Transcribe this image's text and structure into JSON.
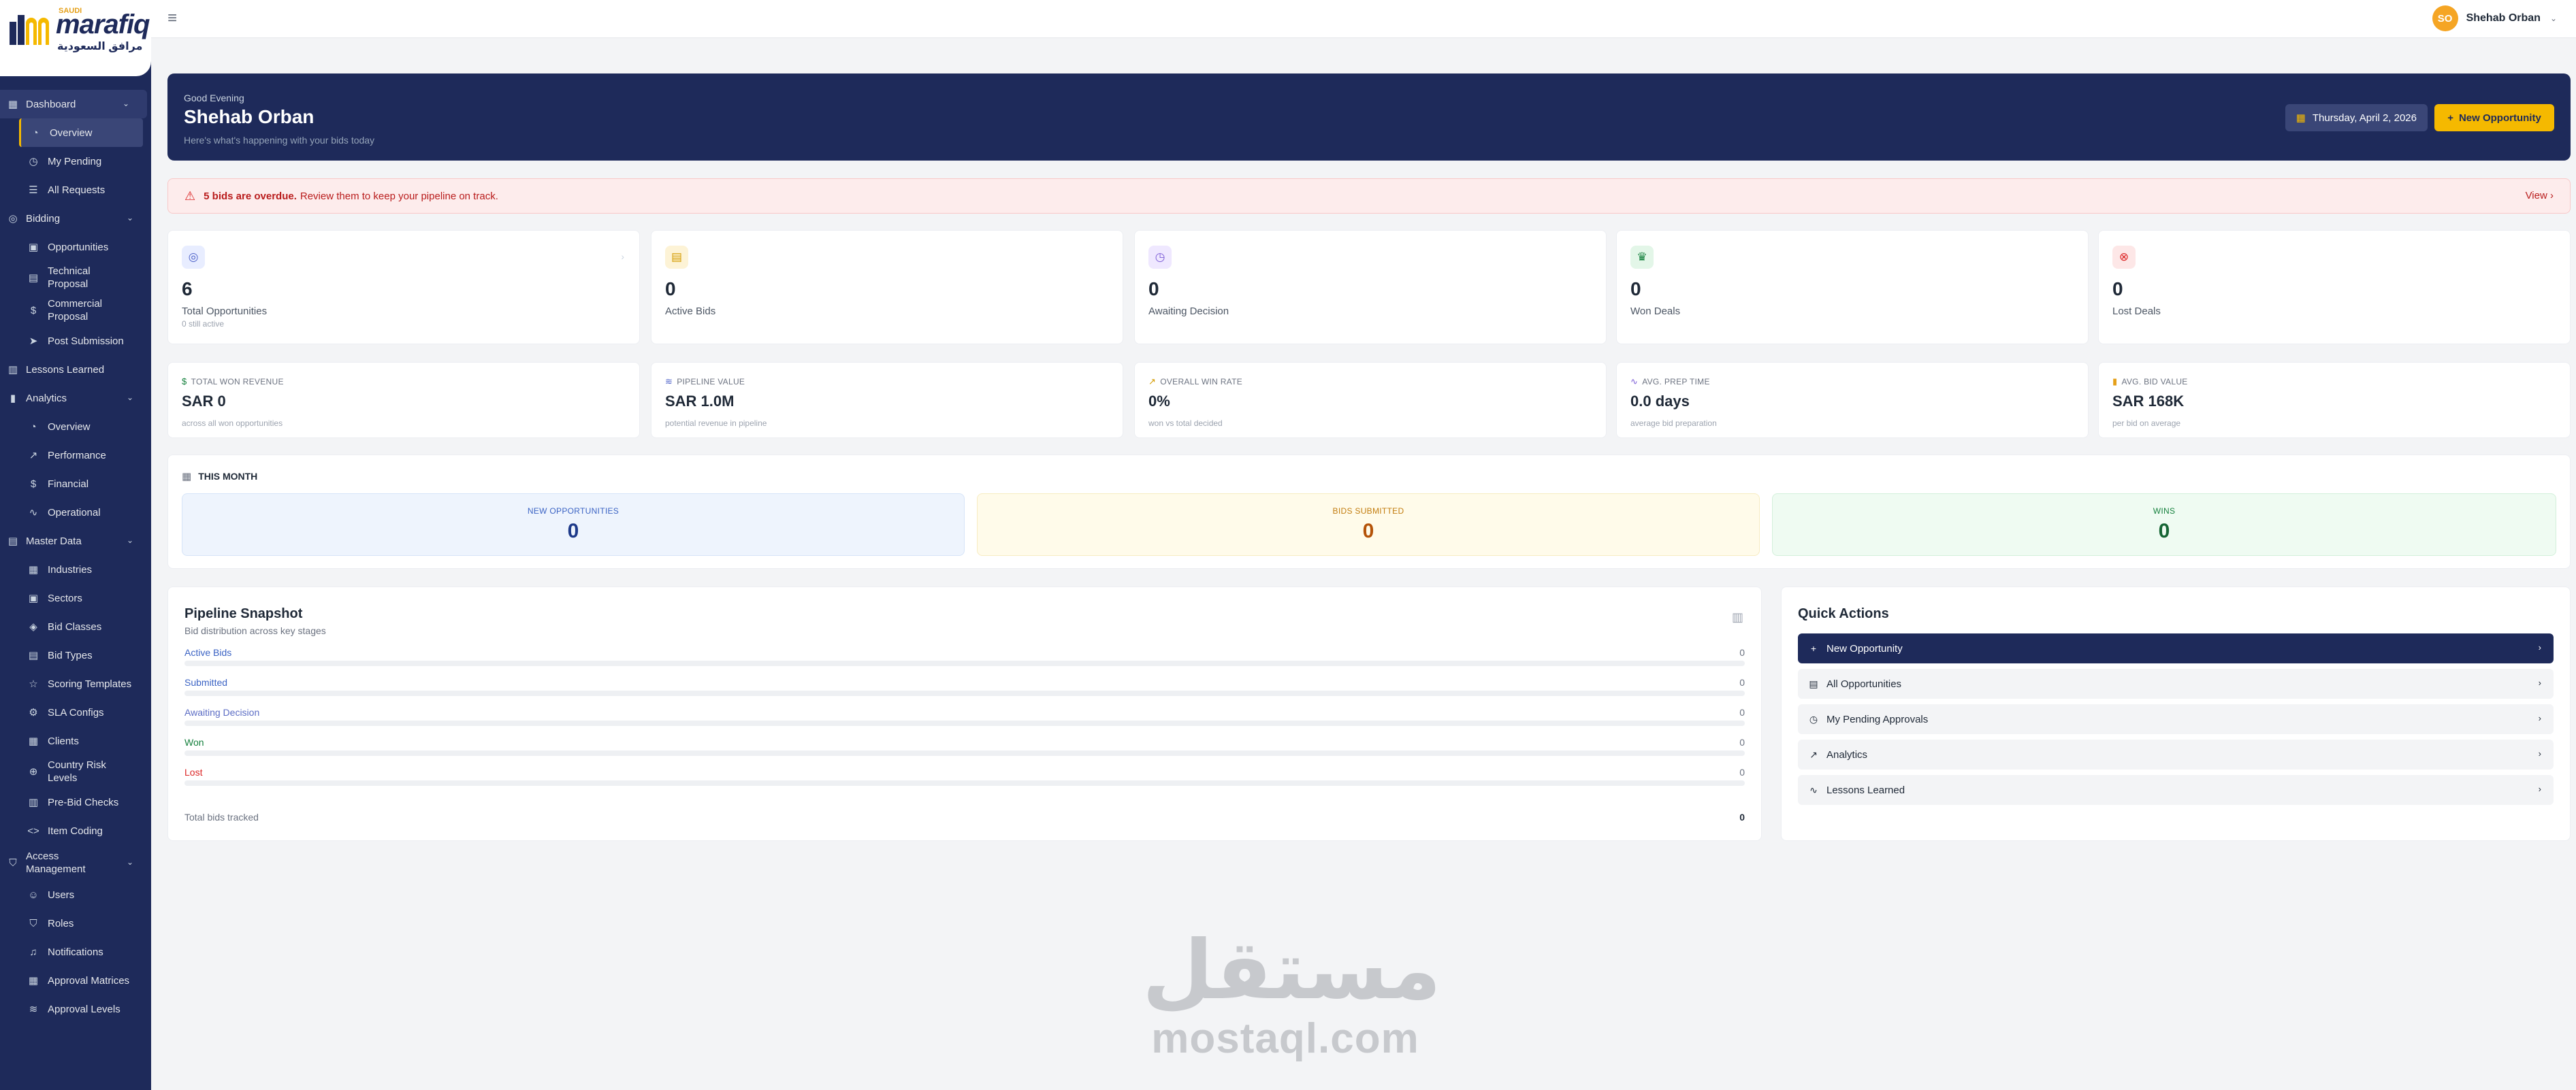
{
  "brand": {
    "name": "marafiq",
    "tag": "SAUDI",
    "arabic": "مرافق السعودية"
  },
  "topbar": {
    "user_initials": "SO",
    "user_name": "Shehab Orban"
  },
  "sidebar": {
    "dashboard": {
      "label": "Dashboard",
      "items": [
        "Overview",
        "My Pending",
        "All Requests"
      ]
    },
    "bidding": {
      "label": "Bidding",
      "items": [
        "Opportunities",
        "Technical Proposal",
        "Commercial Proposal",
        "Post Submission"
      ]
    },
    "lessons": {
      "label": "Lessons Learned"
    },
    "analytics": {
      "label": "Analytics",
      "items": [
        "Overview",
        "Performance",
        "Financial",
        "Operational"
      ]
    },
    "master": {
      "label": "Master Data",
      "items": [
        "Industries",
        "Sectors",
        "Bid Classes",
        "Bid Types",
        "Scoring Templates",
        "SLA Configs",
        "Clients",
        "Country Risk Levels",
        "Pre-Bid Checks",
        "Item Coding"
      ]
    },
    "access": {
      "label": "Access Management",
      "items": [
        "Users",
        "Roles",
        "Notifications",
        "Approval Matrices",
        "Approval Levels"
      ]
    }
  },
  "hero": {
    "greeting": "Good Evening",
    "name": "Shehab Orban",
    "subtitle": "Here's what's happening with your bids today",
    "date": "Thursday, April 2, 2026",
    "new_button": "New Opportunity"
  },
  "alert": {
    "bold": "5 bids are overdue.",
    "text": "Review them to keep your pipeline on track.",
    "view": "View"
  },
  "stats": [
    {
      "value": "6",
      "label": "Total Opportunities",
      "sub": "0 still active"
    },
    {
      "value": "0",
      "label": "Active Bids",
      "sub": ""
    },
    {
      "value": "0",
      "label": "Awaiting Decision",
      "sub": ""
    },
    {
      "value": "0",
      "label": "Won Deals",
      "sub": ""
    },
    {
      "value": "0",
      "label": "Lost Deals",
      "sub": ""
    }
  ],
  "metrics": [
    {
      "label": "TOTAL WON REVENUE",
      "value": "SAR 0",
      "sub": "across all won opportunities"
    },
    {
      "label": "PIPELINE VALUE",
      "value": "SAR 1.0M",
      "sub": "potential revenue in pipeline"
    },
    {
      "label": "OVERALL WIN RATE",
      "value": "0%",
      "sub": "won vs total decided"
    },
    {
      "label": "AVG. PREP TIME",
      "value": "0.0 days",
      "sub": "average bid preparation"
    },
    {
      "label": "AVG. BID VALUE",
      "value": "SAR 168K",
      "sub": "per bid on average"
    }
  ],
  "this_month": {
    "title": "THIS MONTH",
    "boxes": [
      {
        "label": "NEW OPPORTUNITIES",
        "value": "0"
      },
      {
        "label": "BIDS SUBMITTED",
        "value": "0"
      },
      {
        "label": "WINS",
        "value": "0"
      }
    ]
  },
  "pipeline": {
    "title": "Pipeline Snapshot",
    "subtitle": "Bid distribution across key stages",
    "rows": [
      {
        "name": "Active Bids",
        "count": "0",
        "color": "#3b63c4"
      },
      {
        "name": "Submitted",
        "count": "0",
        "color": "#3b63c4"
      },
      {
        "name": "Awaiting Decision",
        "count": "0",
        "color": "#5b6cc4"
      },
      {
        "name": "Won",
        "count": "0",
        "color": "#15803d"
      },
      {
        "name": "Lost",
        "count": "0",
        "color": "#dc2626"
      }
    ],
    "total_label": "Total bids tracked",
    "total_value": "0"
  },
  "quick_actions": {
    "title": "Quick Actions",
    "items": [
      "New Opportunity",
      "All Opportunities",
      "My Pending Approvals",
      "Analytics",
      "Lessons Learned"
    ]
  },
  "watermark": {
    "arabic": "مستقل",
    "latin": "mostaql.com"
  }
}
